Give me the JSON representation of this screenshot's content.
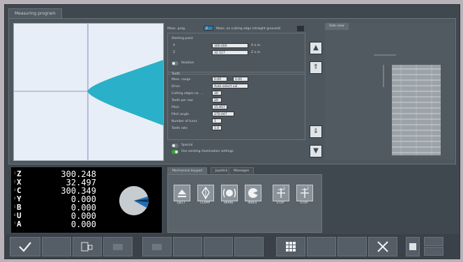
{
  "window": {
    "title": "Measuring program"
  },
  "form": {
    "mode_label": "Meas. prog.",
    "mode_value": "Z",
    "mode_desc": "Meas. on cutting edge (straight grooved)",
    "starting_point_label": "Starting point",
    "x_label": "X",
    "x_value": "300.000",
    "x_suffix": "X e.m.",
    "z_label": "Z",
    "z_value": "32.517",
    "z_suffix": "Z e.m.",
    "relative_label": "Relative",
    "tooth_group_label": "Tooth",
    "mess_range_label": "Mess. range",
    "mess_range_from": "0.00",
    "mess_range_to": "0.00",
    "drive_label": "Drive",
    "drive_value": "Auto select val",
    "cutting_edges_label": "Cutting edges no. ...",
    "cutting_edges_value": "30",
    "teeth_per_row_label": "Teeth per row",
    "teeth_per_row_value": "20",
    "pitch_label": "Pitch",
    "pitch_value": "15.957",
    "pitch_angle_label": "Pitch angle",
    "pitch_angle_value": "270.047",
    "number_of_turns_label": "Number of turns",
    "number_of_turns_value": "1",
    "teeth_rate_label": "Teeth rate",
    "teeth_rate_value": "1.0",
    "special_label": "Special",
    "use_existing_label": "Use existing illumination settings"
  },
  "side_view": {
    "tab_label": "Side view"
  },
  "axes": [
    {
      "index": "1",
      "name": "Z",
      "value": "300.248"
    },
    {
      "index": "2",
      "name": "X",
      "value": "32.497"
    },
    {
      "index": "3",
      "name": "C",
      "value": "300.349"
    },
    {
      "index": "4",
      "name": "Y",
      "value": "0.000"
    },
    {
      "index": "5",
      "name": "B",
      "value": "0.000"
    },
    {
      "index": "6",
      "name": "U",
      "value": "0.000"
    },
    {
      "index": "7",
      "name": "A",
      "value": "0.000"
    }
  ],
  "function_tabs": [
    {
      "label": "Mechanical keypad"
    },
    {
      "label": "Joystick"
    },
    {
      "label": "Messages"
    }
  ],
  "function_buttons": [
    {
      "label": "EJECT",
      "icon": "eject-icon"
    },
    {
      "label": "CLAMP",
      "icon": "clamp-icon"
    },
    {
      "label": "BRAKE",
      "icon": "brake-icon"
    },
    {
      "label": "INDEX",
      "icon": "index-icon"
    },
    {
      "label": "STOP",
      "icon": "stop-1-icon"
    },
    {
      "label": "STOP",
      "icon": "stop-2-icon"
    }
  ],
  "toolbar": {
    "confirm_icon": "checkmark-icon",
    "save_icon": "save-file-icon",
    "grid_icon": "grid-icon",
    "cancel_icon": "close-icon"
  },
  "colors": {
    "accent_cyan": "#2ab0c8",
    "toggle_on": "#3aa13a",
    "panel": "#4f575e",
    "readout_bg": "#000000"
  }
}
